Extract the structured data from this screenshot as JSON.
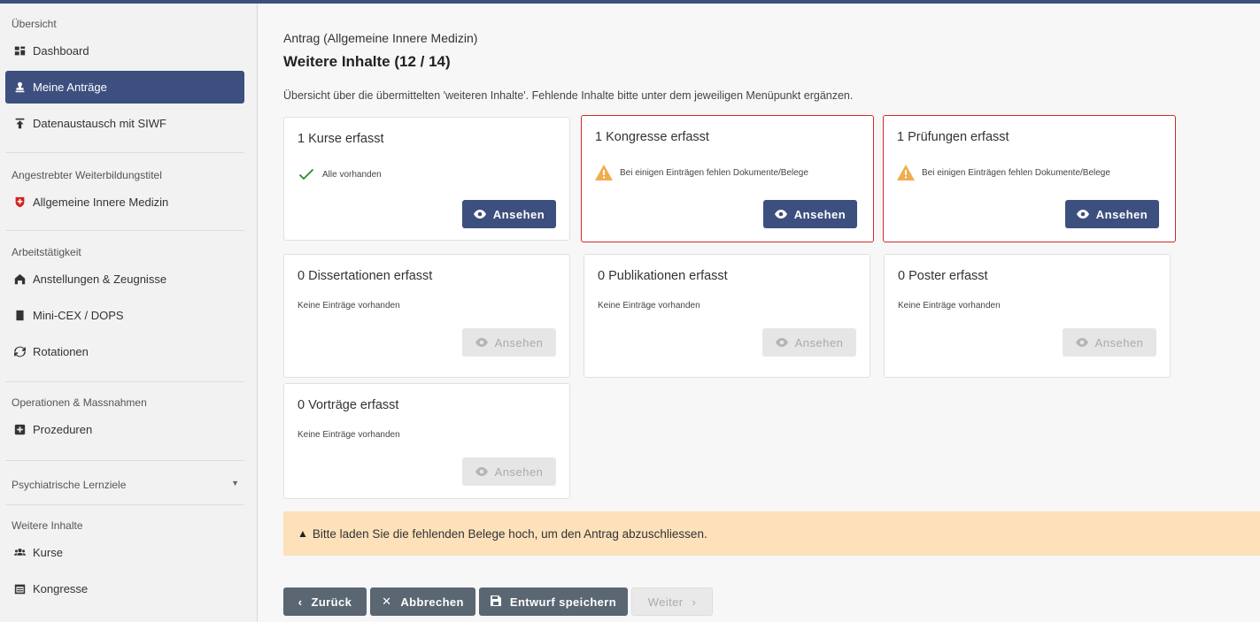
{
  "colors": {
    "primary": "#3d4f7e",
    "warning": "#f0ad4e",
    "success": "#2e8b2e",
    "alert_bg": "#fde1ba",
    "highlight_border": "#d02a2a"
  },
  "sidebar": {
    "sections": {
      "overview": "Übersicht",
      "title": "Angestrebter Weiterbildungstitel",
      "work": "Arbeitstätigkeit",
      "ops": "Operationen & Massnahmen",
      "psych": "Psychiatrische Lernziele",
      "more": "Weitere Inhalte"
    },
    "items": {
      "dashboard": "Dashboard",
      "antraege": "Meine Anträge",
      "siwf": "Datenaustausch mit SIWF",
      "aim": "Allgemeine Innere Medizin",
      "anstellungen": "Anstellungen & Zeugnisse",
      "minicex": "Mini-CEX / DOPS",
      "rotationen": "Rotationen",
      "prozeduren": "Prozeduren",
      "kurse": "Kurse",
      "kongresse": "Kongresse"
    }
  },
  "main": {
    "subtitle": "Antrag (Allgemeine Innere Medizin)",
    "title": "Weitere Inhalte (12 / 14)",
    "description": "Übersicht über die übermittelten 'weiteren Inhalte'. Fehlende Inhalte bitte unter dem jeweiligen Menüpunkt ergänzen.",
    "cards": [
      {
        "title": "1 Kurse erfasst",
        "status": "Alle vorhanden",
        "status_type": "ok",
        "button": "Ansehen",
        "enabled": true
      },
      {
        "title": "1 Kongresse erfasst",
        "status": "Bei einigen Einträgen fehlen Dokumente/Belege",
        "status_type": "warning",
        "button": "Ansehen",
        "enabled": true
      },
      {
        "title": "1 Prüfungen erfasst",
        "status": "Bei einigen Einträgen fehlen Dokumente/Belege",
        "status_type": "warning",
        "button": "Ansehen",
        "enabled": true
      },
      {
        "title": "0 Dissertationen erfasst",
        "status": "Keine Einträge vorhanden",
        "status_type": "empty",
        "button": "Ansehen",
        "enabled": false
      },
      {
        "title": "0 Publikationen erfasst",
        "status": "Keine Einträge vorhanden",
        "status_type": "empty",
        "button": "Ansehen",
        "enabled": false
      },
      {
        "title": "0 Poster erfasst",
        "status": "Keine Einträge vorhanden",
        "status_type": "empty",
        "button": "Ansehen",
        "enabled": false
      },
      {
        "title": "0 Vorträge erfasst",
        "status": "Keine Einträge vorhanden",
        "status_type": "empty",
        "button": "Ansehen",
        "enabled": false
      }
    ],
    "alert": "Bitte laden Sie die fehlenden Belege hoch, um den Antrag abzuschliessen."
  },
  "footer": {
    "back": "Zurück",
    "cancel": "Abbrechen",
    "save": "Entwurf speichern",
    "next": "Weiter"
  }
}
